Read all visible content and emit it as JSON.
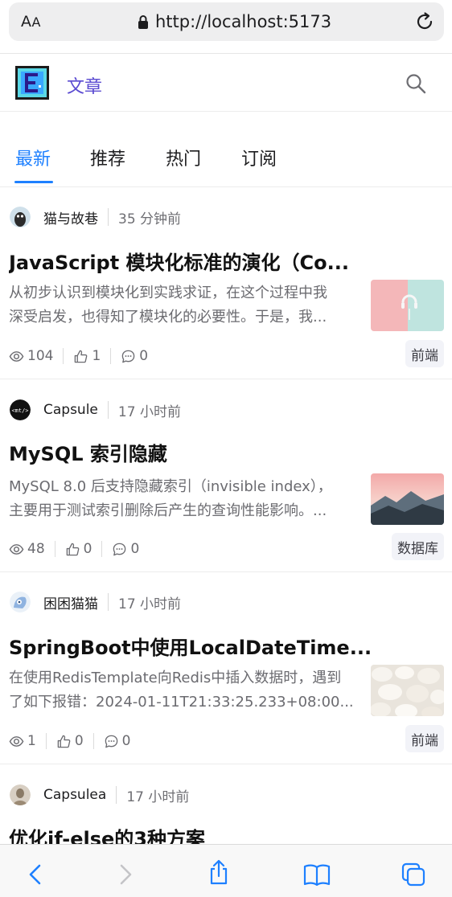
{
  "browser": {
    "aa_label_big": "A",
    "aa_label_small": "A",
    "url": "http://localhost:5173"
  },
  "header": {
    "app_title": "文章",
    "logo_letter": "E"
  },
  "tabs": [
    {
      "label": "最新",
      "active": true
    },
    {
      "label": "推荐",
      "active": false
    },
    {
      "label": "热门",
      "active": false
    },
    {
      "label": "订阅",
      "active": false
    }
  ],
  "articles": [
    {
      "author": "猫与故巷",
      "time": "35 分钟前",
      "title": "JavaScript 模块化标准的演化（Co...",
      "summary_line1": "从初步认识到模块化到实践求证，在这个过程中我",
      "summary_line2": "深受启发，也得知了模块化的必要性。于是，我...",
      "views": "104",
      "likes": "1",
      "comments": "0",
      "tag": "前端"
    },
    {
      "author": "Capsule",
      "time": "17 小时前",
      "title": "MySQL 索引隐藏",
      "summary_line1": "MySQL 8.0 后支持隐藏索引（invisible index），",
      "summary_line2": "主要用于测试索引删除后产生的查询性能影响。...",
      "views": "48",
      "likes": "0",
      "comments": "0",
      "tag": "数据库"
    },
    {
      "author": "困困猫猫",
      "time": "17 小时前",
      "title": "SpringBoot中使用LocalDateTime...",
      "summary_line1": "在使用RedisTemplate向Redis中插入数据时，遇到",
      "summary_line2": "了如下报错：2024-01-11T21:33:25.233+08:00...",
      "views": "1",
      "likes": "0",
      "comments": "0",
      "tag": "前端"
    },
    {
      "author": "Capsulea",
      "time": "17 小时前",
      "title": "优化if-else的3种方案"
    }
  ],
  "colors": {
    "accent": "#1e80ff",
    "brand": "#5a4ad1"
  },
  "icons": [
    "lock-icon",
    "reload-icon",
    "search-icon",
    "eye-icon",
    "thumb-up-icon",
    "comment-icon",
    "back-icon",
    "forward-icon",
    "share-icon",
    "bookmarks-icon",
    "tabs-icon"
  ]
}
